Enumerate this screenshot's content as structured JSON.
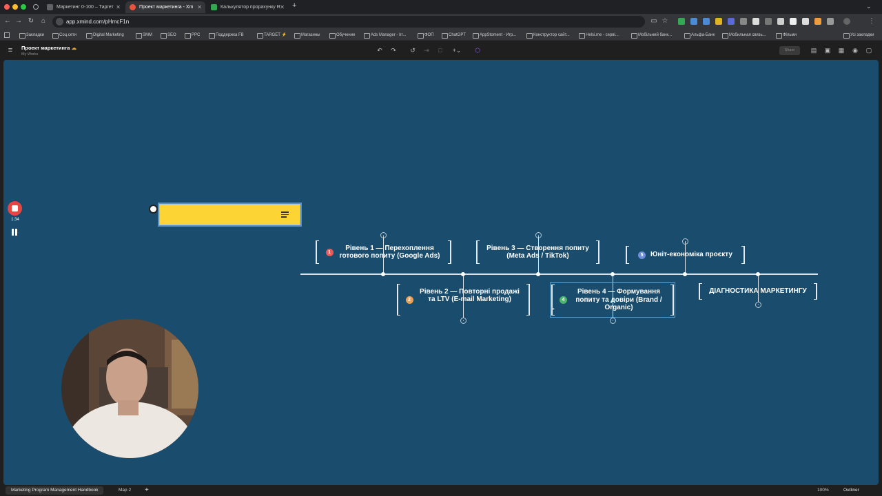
{
  "browser": {
    "tabs": [
      {
        "title": "Маркетинг 0-100 – Таргет",
        "favicon_color": "#5f6368"
      },
      {
        "title": "Проект маркетинга - Xm",
        "favicon_color": "#e8553c"
      },
      {
        "title": "Калькулятор прорахунку R",
        "favicon_color": "#33a852"
      }
    ],
    "new_tab_label": "+",
    "url": "app.xmind.com/pHmcF1n",
    "bookmarks": [
      "Закладки",
      "Соц.сети",
      "Digital Marketing",
      "SMM",
      "SEO",
      "PPC",
      "Поддержка FB",
      "TARGET ⚡",
      "Магазины",
      "Обучение",
      "Ads Manager - Irr...",
      "ФОП",
      "ChatGPT",
      "AppStoment - Игр...",
      "Конструктор сайт...",
      "Helsi.me - серві...",
      "Мобільний банк...",
      "Альфа-Банк",
      "Мобильная связь...",
      "Фільми"
    ],
    "all_bookmarks_label": "Усі закладки"
  },
  "app": {
    "doc_title": "Проект маркетинга",
    "doc_subtitle": "My Works",
    "share_label": "Share"
  },
  "map": {
    "central_topic": "",
    "nodes": [
      {
        "label": "Рівень 1 — Перехоплення готового попиту (Google Ads)",
        "badge": "1",
        "badge_color": "#e85a5a"
      },
      {
        "label": "Рівень 2 — Повторні продажі та LTV (E-mail Marketing)",
        "badge": "2",
        "badge_color": "#f0a04a"
      },
      {
        "label": "Рівень 3 — Створення попиту (Meta Ads / TikTok)",
        "badge": "",
        "badge_color": ""
      },
      {
        "label": "Рівень 4 — Формування попиту та довіри (Brand / Organic)",
        "badge": "4",
        "badge_color": "#4cb86a"
      },
      {
        "label": "Юніт-економіка проєкту",
        "badge": "5",
        "badge_color": "#6e8fe0"
      },
      {
        "label": "ДІАГНОСТИКА МАРКЕТИНГУ",
        "badge": "",
        "badge_color": ""
      }
    ]
  },
  "recorder": {
    "time": "1:34"
  },
  "bottom": {
    "sheets": [
      "Marketing Program Management Handbook",
      "Map 2"
    ],
    "add_sheet": "+",
    "zoom": "100%",
    "outliner": "Outliner"
  }
}
